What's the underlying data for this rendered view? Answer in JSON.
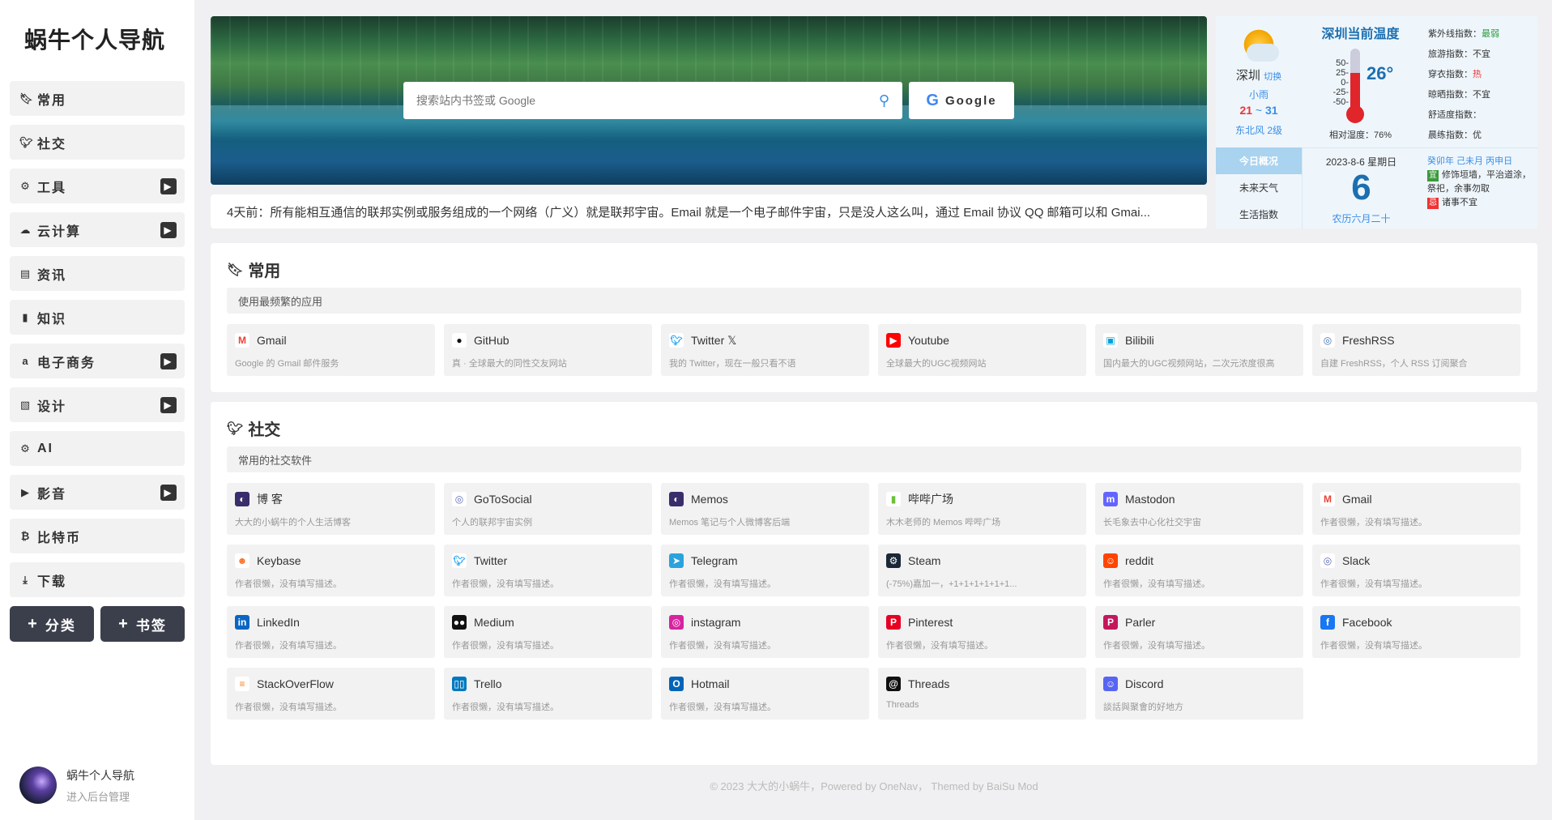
{
  "sidebar": {
    "logo": "蜗牛个人导航",
    "items": [
      {
        "icon": "bookmark-icon",
        "glyph": "🔖︎",
        "label": "常用",
        "arrow": false
      },
      {
        "icon": "twitter-icon",
        "glyph": "🐦︎",
        "label": "社交",
        "arrow": false
      },
      {
        "icon": "android-icon",
        "glyph": "⚙",
        "label": "工具",
        "arrow": true
      },
      {
        "icon": "cloud-icon",
        "glyph": "☁",
        "label": "云计算",
        "arrow": true
      },
      {
        "icon": "newspaper-icon",
        "glyph": "▤",
        "label": "资讯",
        "arrow": false
      },
      {
        "icon": "book-icon",
        "glyph": "▮",
        "label": "知识",
        "arrow": false
      },
      {
        "icon": "amazon-icon",
        "glyph": "a",
        "label": "电子商务",
        "arrow": true
      },
      {
        "icon": "image-icon",
        "glyph": "▧",
        "label": "设计",
        "arrow": true
      },
      {
        "icon": "android-icon",
        "glyph": "⚙",
        "label": "AI",
        "arrow": false
      },
      {
        "icon": "youtube-icon",
        "glyph": "▶",
        "label": "影音",
        "arrow": true
      },
      {
        "icon": "bitcoin-icon",
        "glyph": "₿",
        "label": "比特币",
        "arrow": false
      },
      {
        "icon": "download-icon",
        "glyph": "⤓",
        "label": "下载",
        "arrow": false
      }
    ],
    "add_category": "分类",
    "add_bookmark": "书签",
    "user_name": "蜗牛个人导航",
    "user_sub": "进入后台管理"
  },
  "search": {
    "placeholder": "搜索站内书签或 Google",
    "button_label": "Google"
  },
  "notice": "4天前：所有能相互通信的联邦实例或服务组成的一个网络（广义）就是联邦宇宙。Email 就是一个电子邮件宇宙，只是没人这么叫，通过 Email 协议 QQ 邮箱可以和 Gmai...",
  "weather": {
    "city": "深圳",
    "switch": "切换",
    "condition": "小雨",
    "low": "21",
    "tilde": "~",
    "high": "31",
    "wind": "东北风 2级",
    "title": "深圳当前温度",
    "scale": [
      "50-",
      "25-",
      "0-",
      "-25-",
      "-50-"
    ],
    "temp": "26°",
    "humidity": "相对湿度：76%",
    "indices": [
      {
        "label": "紫外线指数：",
        "value": "最弱",
        "tone": "green"
      },
      {
        "label": "旅游指数：",
        "value": "不宜",
        "tone": "normal"
      },
      {
        "label": "穿衣指数：",
        "value": "热",
        "tone": "red"
      },
      {
        "label": "晾晒指数：",
        "value": "不宜",
        "tone": "normal"
      },
      {
        "label": "舒适度指数：",
        "value": "",
        "tone": "normal"
      },
      {
        "label": "晨练指数：",
        "value": "优",
        "tone": "normal"
      }
    ],
    "tabs": [
      "今日概况",
      "未来天气",
      "生活指数"
    ],
    "date": "2023-8-6 星期日",
    "day": "6",
    "lunar": "农历六月二十",
    "ganzhi": "癸卯年 己未月 丙申日",
    "yi_label": "宜",
    "yi": "修饰垣墙，平治道涂，祭祀，余事勿取",
    "ji_label": "忌",
    "ji": "诸事不宜"
  },
  "sections": [
    {
      "title": "常用",
      "icon": "bookmark-icon",
      "glyph": "🔖︎",
      "desc": "使用最频繁的应用",
      "cards": [
        {
          "name": "Gmail",
          "desc": "Google 的 Gmail 邮件服务",
          "icon": "gmail-icon",
          "glyph": "M",
          "color": "#ffffff",
          "fg": "#ea4335"
        },
        {
          "name": "GitHub",
          "desc": "真 · 全球最大的同性交友网站",
          "icon": "github-icon",
          "glyph": "●",
          "color": "#ffffff",
          "fg": "#111111"
        },
        {
          "name": "Twitter 𝕏",
          "desc": "我的 Twitter，现在一般只看不语",
          "icon": "twitter-icon",
          "glyph": "🐦︎",
          "color": "#ffffff",
          "fg": "#1da1f2"
        },
        {
          "name": "Youtube",
          "desc": "全球最大的UGC视频网站",
          "icon": "youtube-icon",
          "glyph": "▶",
          "color": "#ff0000",
          "fg": "#ffffff"
        },
        {
          "name": "Bilibili",
          "desc": "国内最大的UGC视频网站，二次元浓度很高",
          "icon": "bilibili-icon",
          "glyph": "▣",
          "color": "#ffffff",
          "fg": "#00a1d6"
        },
        {
          "name": "FreshRSS",
          "desc": "自建 FreshRSS，个人 RSS 订阅聚合",
          "icon": "freshrss-icon",
          "glyph": "◎",
          "color": "#ffffff",
          "fg": "#3b6fb6"
        }
      ]
    },
    {
      "title": "社交",
      "icon": "twitter-icon",
      "glyph": "🐦︎",
      "desc": "常用的社交软件",
      "cards": [
        {
          "name": "博 客",
          "desc": "大大的小蜗牛的个人生活博客",
          "icon": "blog-icon",
          "glyph": "◐",
          "color": "#3a2d6b",
          "fg": "#ffffff"
        },
        {
          "name": "GoToSocial",
          "desc": "个人的联邦宇宙实例",
          "icon": "gotosocial-icon",
          "glyph": "◎",
          "color": "#ffffff",
          "fg": "#5b6bb5"
        },
        {
          "name": "Memos",
          "desc": "Memos 笔记与个人微博客后端",
          "icon": "memos-icon",
          "glyph": "◐",
          "color": "#3a2d6b",
          "fg": "#ffffff"
        },
        {
          "name": "哔哔广场",
          "desc": "木木老师的 Memos 哔哔广场",
          "icon": "bibi-icon",
          "glyph": "▮",
          "color": "#ffffff",
          "fg": "#6cbf3a"
        },
        {
          "name": "Mastodon",
          "desc": "长毛象去中心化社交宇宙",
          "icon": "mastodon-icon",
          "glyph": "m",
          "color": "#6364ff",
          "fg": "#ffffff"
        },
        {
          "name": "Gmail",
          "desc": "作者很懒，没有填写描述。",
          "icon": "gmail-icon",
          "glyph": "M",
          "color": "#ffffff",
          "fg": "#ea4335"
        },
        {
          "name": "Keybase",
          "desc": "作者很懒，没有填写描述。",
          "icon": "keybase-icon",
          "glyph": "☻",
          "color": "#ffffff",
          "fg": "#ff6f21"
        },
        {
          "name": "Twitter",
          "desc": "作者很懒，没有填写描述。",
          "icon": "twitter-icon",
          "glyph": "🐦︎",
          "color": "#ffffff",
          "fg": "#1da1f2"
        },
        {
          "name": "Telegram",
          "desc": "作者很懒，没有填写描述。",
          "icon": "telegram-icon",
          "glyph": "➤",
          "color": "#2aa3dd",
          "fg": "#ffffff"
        },
        {
          "name": "Steam",
          "desc": "(-75%)嘉加一，+1+1+1+1+1+1...",
          "icon": "steam-icon",
          "glyph": "⚙",
          "color": "#1b2838",
          "fg": "#ffffff"
        },
        {
          "name": "reddit",
          "desc": "作者很懒，没有填写描述。",
          "icon": "reddit-icon",
          "glyph": "☺",
          "color": "#ff4500",
          "fg": "#ffffff"
        },
        {
          "name": "Slack",
          "desc": "作者很懒，没有填写描述。",
          "icon": "slack-icon",
          "glyph": "◎",
          "color": "#ffffff",
          "fg": "#5b6bb5"
        },
        {
          "name": "LinkedIn",
          "desc": "作者很懒，没有填写描述。",
          "icon": "linkedin-icon",
          "glyph": "in",
          "color": "#0a66c2",
          "fg": "#ffffff"
        },
        {
          "name": "Medium",
          "desc": "作者很懒，没有填写描述。",
          "icon": "medium-icon",
          "glyph": "●●",
          "color": "#111111",
          "fg": "#ffffff"
        },
        {
          "name": "instagram",
          "desc": "作者很懒，没有填写描述。",
          "icon": "instagram-icon",
          "glyph": "◎",
          "color": "#d6249f",
          "fg": "#ffffff"
        },
        {
          "name": "Pinterest",
          "desc": "作者很懒，没有填写描述。",
          "icon": "pinterest-icon",
          "glyph": "P",
          "color": "#e60023",
          "fg": "#ffffff"
        },
        {
          "name": "Parler",
          "desc": "作者很懒，没有填写描述。",
          "icon": "parler-icon",
          "glyph": "P",
          "color": "#c3185b",
          "fg": "#ffffff"
        },
        {
          "name": "Facebook",
          "desc": "作者很懒，没有填写描述。",
          "icon": "facebook-icon",
          "glyph": "f",
          "color": "#1877f2",
          "fg": "#ffffff"
        },
        {
          "name": "StackOverFlow",
          "desc": "作者很懒，没有填写描述。",
          "icon": "stackoverflow-icon",
          "glyph": "≡",
          "color": "#ffffff",
          "fg": "#f48024"
        },
        {
          "name": "Trello",
          "desc": "作者很懒，没有填写描述。",
          "icon": "trello-icon",
          "glyph": "▯▯",
          "color": "#0079bf",
          "fg": "#ffffff"
        },
        {
          "name": "Hotmail",
          "desc": "作者很懒，没有填写描述。",
          "icon": "hotmail-icon",
          "glyph": "O",
          "color": "#0364b8",
          "fg": "#ffffff"
        },
        {
          "name": "Threads",
          "desc": "Threads",
          "icon": "threads-icon",
          "glyph": "@",
          "color": "#111111",
          "fg": "#ffffff"
        },
        {
          "name": "Discord",
          "desc": "談話與聚會的好地方",
          "icon": "discord-icon",
          "glyph": "☺",
          "color": "#5865f2",
          "fg": "#ffffff"
        }
      ]
    }
  ],
  "footer": "© 2023 大大的小蜗牛，Powered by OneNav， Themed by BaiSu Mod"
}
